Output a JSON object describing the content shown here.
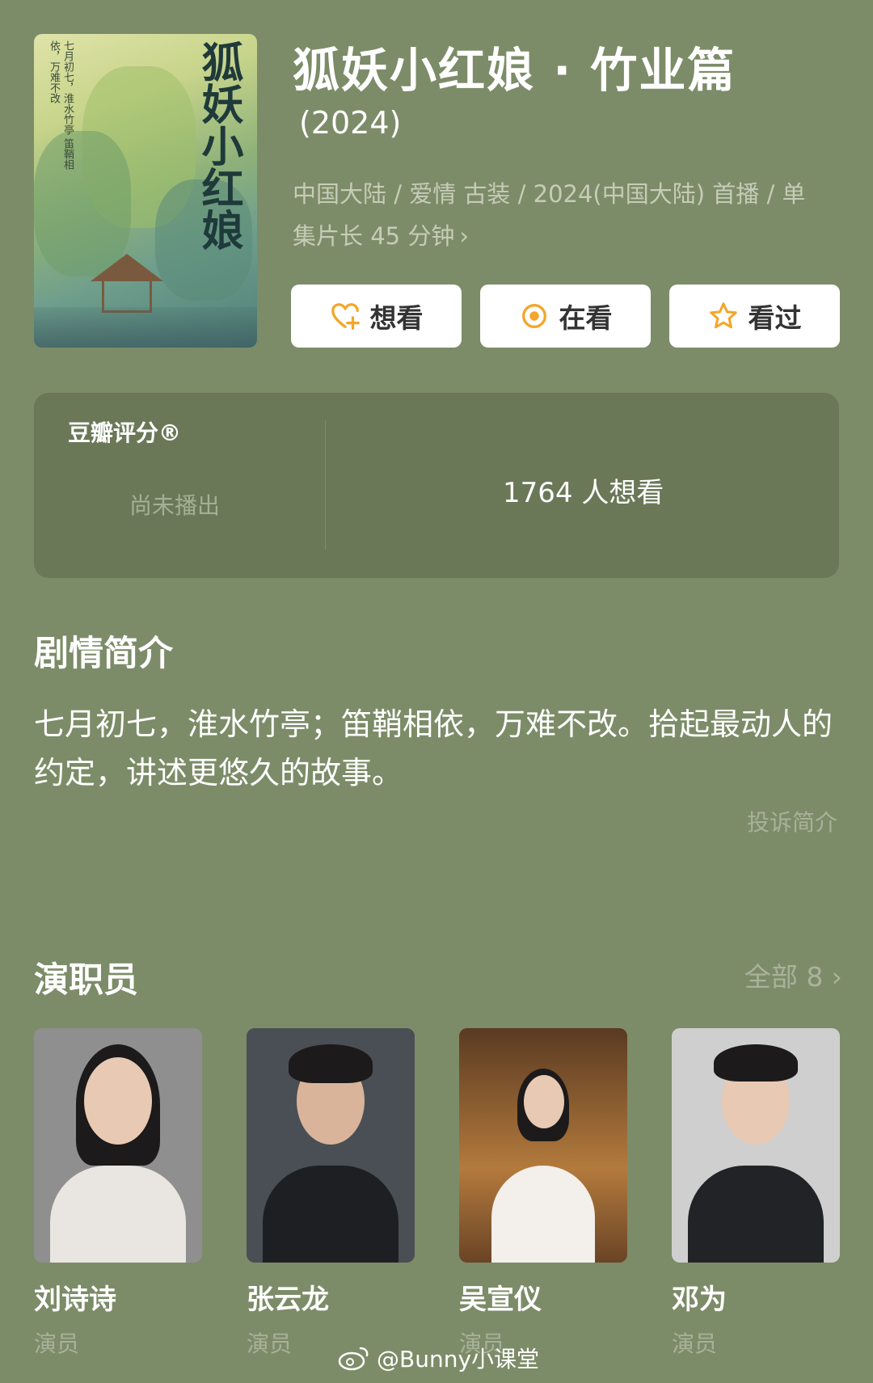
{
  "show": {
    "title": "狐妖小红娘 · 竹业篇",
    "year": "(2024)",
    "meta_line1": "中国大陆 / 爱情 古装 / 2024(中国大陆) 首播 / 单",
    "meta_line2": "集片长 45 分钟",
    "meta_chevron": "›"
  },
  "poster": {
    "title_text": "狐妖小红娘",
    "subtitle_text": "七月初七，淮水竹亭 笛鞘相依，万难不改"
  },
  "actions": {
    "want_label": "想看",
    "watching_label": "在看",
    "watched_label": "看过",
    "icon_color": "#f4a62a"
  },
  "rating": {
    "label": "豆瓣评分®",
    "status": "尚未播出",
    "want_count": "1764 人想看"
  },
  "synopsis": {
    "heading": "剧情简介",
    "text": "七月初七，淮水竹亭；笛鞘相依，万难不改。拾起最动人的约定，讲述更悠久的故事。",
    "report_link": "投诉简介"
  },
  "cast": {
    "heading": "演职员",
    "all_link": "全部 8 ›",
    "members": [
      {
        "name": "刘诗诗",
        "role": "演员"
      },
      {
        "name": "张云龙",
        "role": "演员"
      },
      {
        "name": "吴宣仪",
        "role": "演员"
      },
      {
        "name": "邓为",
        "role": "演员"
      }
    ]
  },
  "watermark": {
    "text": "@Bunny小课堂"
  }
}
